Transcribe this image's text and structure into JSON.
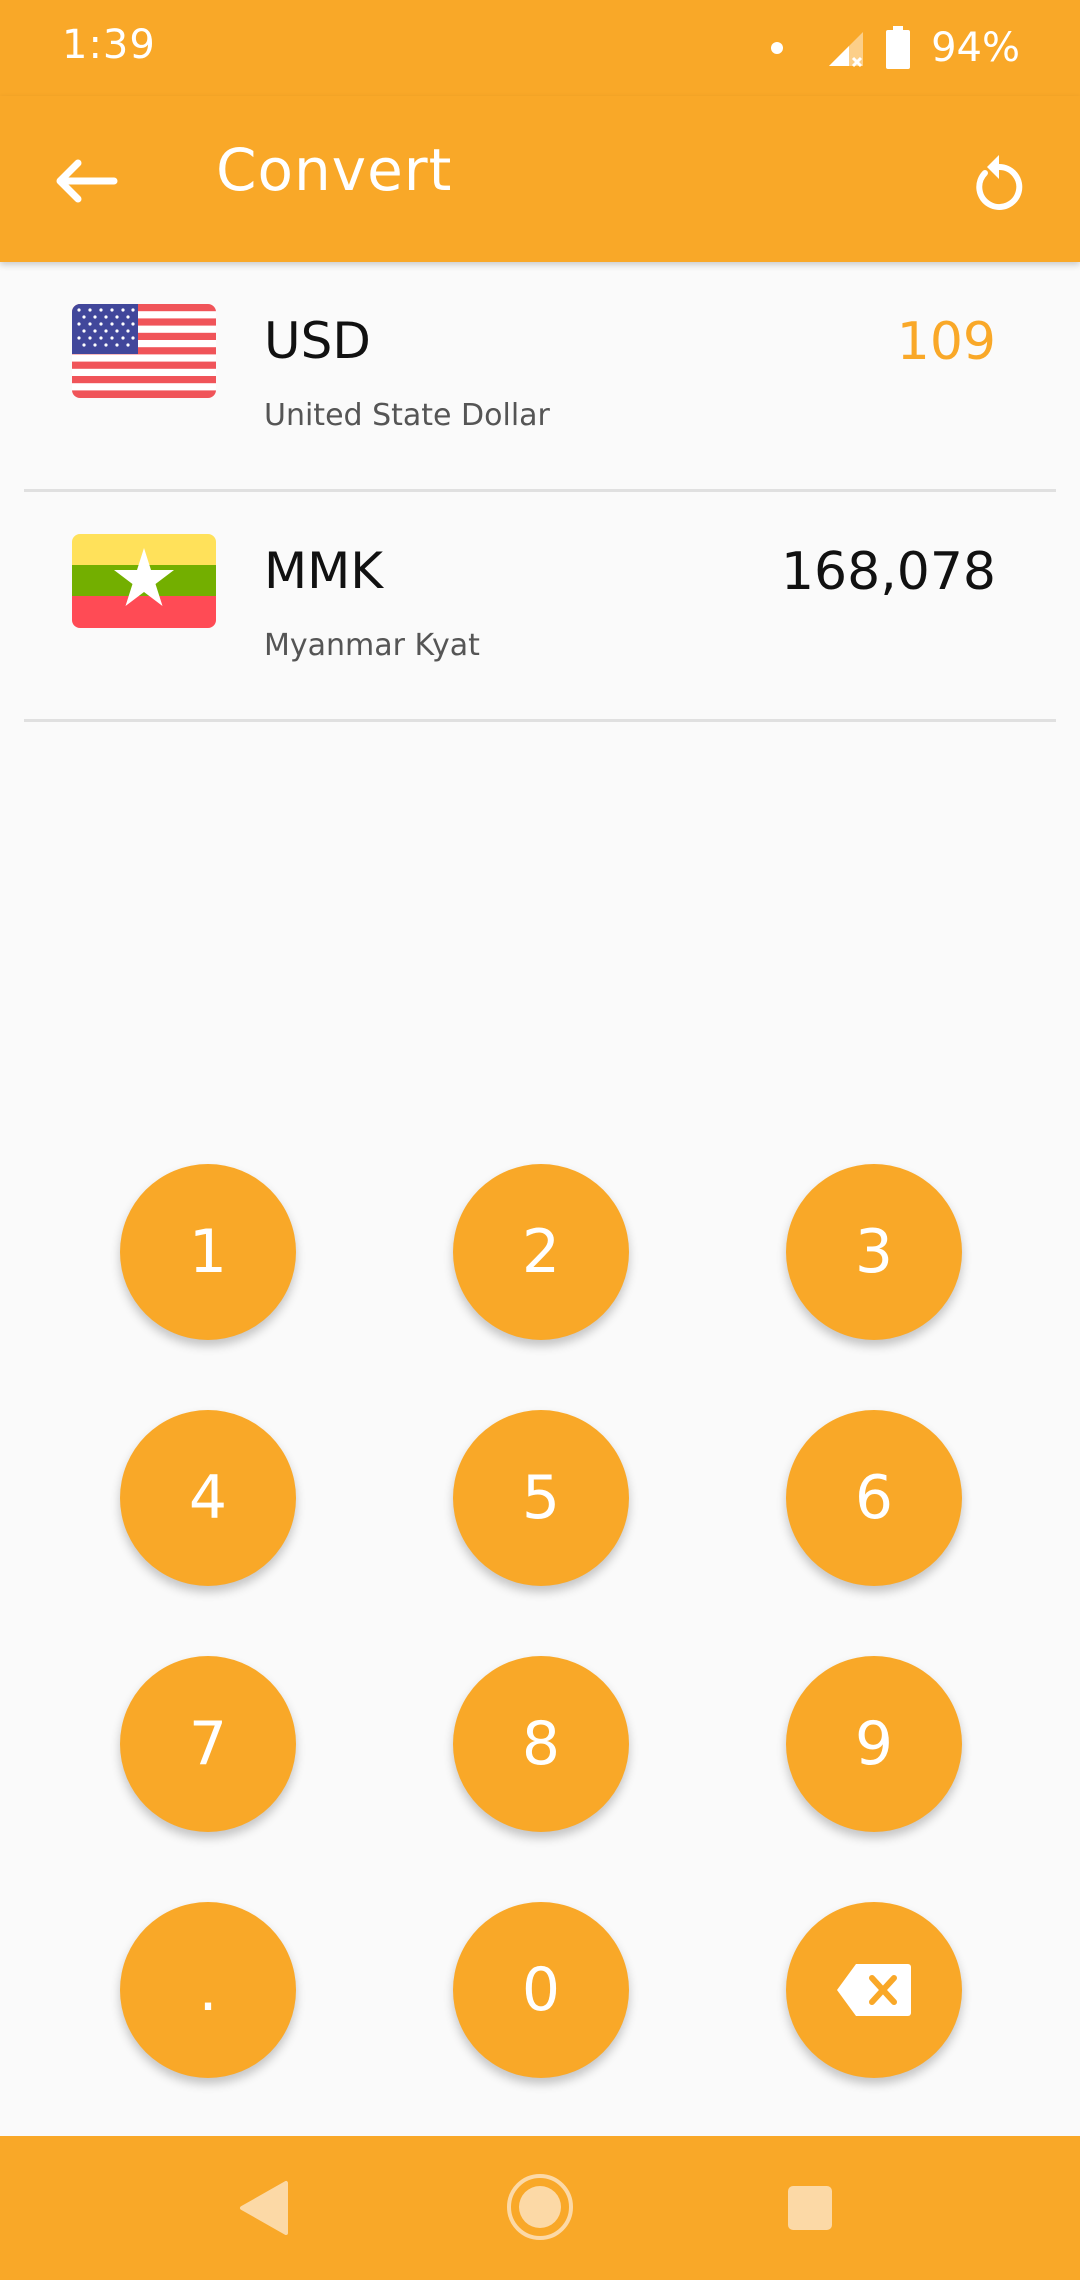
{
  "status_bar": {
    "time": "1:39",
    "battery": "94%"
  },
  "app_bar": {
    "title": "Convert"
  },
  "currencies": [
    {
      "code": "USD",
      "name": "United State Dollar",
      "value": "109",
      "flag": "us-flag-icon",
      "active": true
    },
    {
      "code": "MMK",
      "name": "Myanmar Kyat",
      "value": "168,078",
      "flag": "myanmar-flag-icon",
      "active": false
    }
  ],
  "keypad": {
    "keys": [
      "1",
      "2",
      "3",
      "4",
      "5",
      "6",
      "7",
      "8",
      "9",
      ".",
      "0"
    ],
    "backspace_icon": "backspace-icon"
  },
  "colors": {
    "accent": "#F9A828",
    "background": "#FAFAFA",
    "divider": "#E0E0E0"
  },
  "nav_bar": {
    "icons": [
      "nav-back-icon",
      "nav-home-icon",
      "nav-recent-icon"
    ]
  }
}
